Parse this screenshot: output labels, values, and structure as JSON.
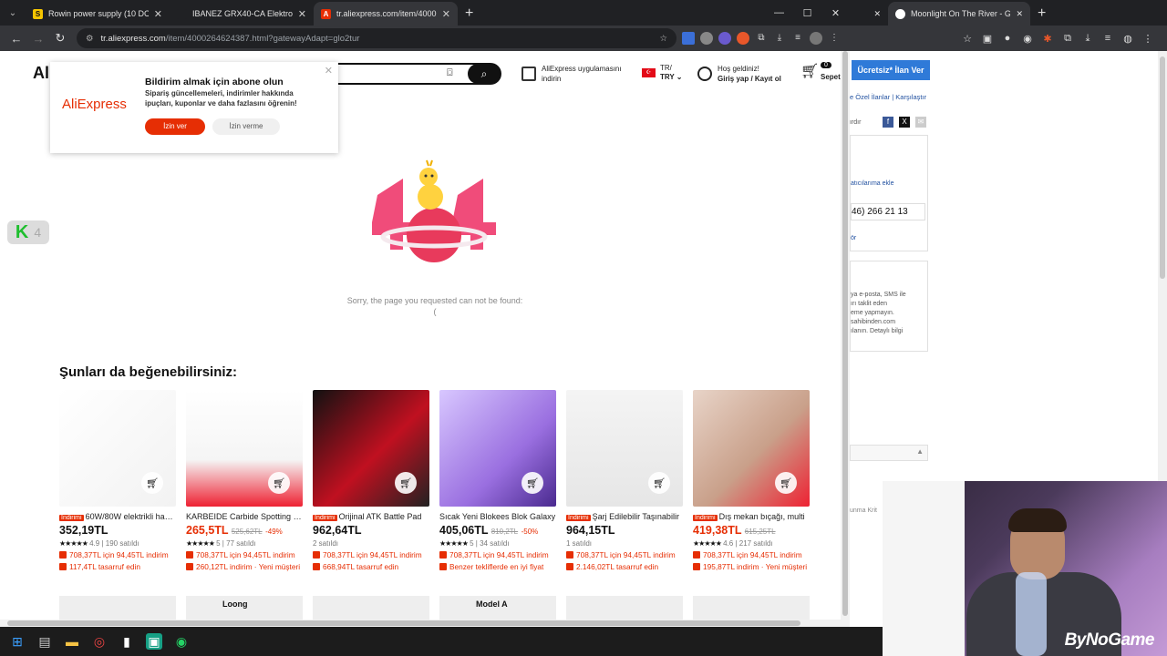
{
  "browser": {
    "tabs": [
      {
        "title": "Rowin power supply (10 DC Ou",
        "favicon": "S",
        "favicon_color": "#f7c600"
      },
      {
        "title": "IBANEZ GRX40-CA Elektro Gitar",
        "favicon": "",
        "favicon_color": "#202124"
      },
      {
        "title": "tr.aliexpress.com/item/4000264",
        "favicon": "A",
        "favicon_color": "#e62e04"
      }
    ],
    "url_host": "tr.aliexpress.com",
    "url_path": "/item/4000264624387.html?gatewayAdapt=glo2tur"
  },
  "header": {
    "logo_fragment": "Al",
    "app_line1": "AliExpress uygulamasını",
    "app_line2": "indirin",
    "lang_line1": "TR/",
    "lang_line2": "TRY",
    "user_line1": "Hoş geldiniz!",
    "user_line2": "Giriş yap / Kayıt ol",
    "cart_count": "0",
    "cart_label": "Sepet"
  },
  "popup": {
    "logo": "AliExpress",
    "title": "Bildirim almak için abone olun",
    "text": "Sipariş güncellemeleri, indirimler hakkında ipuçları, kuponlar ve daha fazlasını öğrenin!",
    "allow": "İzin ver",
    "deny": "İzin verme"
  },
  "k_badge": {
    "letter": "K",
    "count": "4"
  },
  "error": {
    "message": "Sorry, the page you requested can not be found:("
  },
  "section_title": "Şunları da beğenebilirsiniz:",
  "products": [
    {
      "tag": "İndirimi",
      "title": "60W/80W elektrikli havya",
      "price": "352,19TL",
      "price_red": false,
      "old": "",
      "disc": "",
      "stars": "★★★★★",
      "rating": "4.9",
      "sold": "190 satıldı",
      "promo1": "708,37TL için 94,45TL indirim",
      "promo2": "117,4TL tasarruf edin",
      "img": "solder"
    },
    {
      "tag": "",
      "title": "KARBEIDE Carbide Spotting Drill",
      "price": "265,5TL",
      "price_red": true,
      "old": "525,62TL",
      "disc": "-49%",
      "stars": "★★★★★",
      "rating": "5",
      "sold": "77 satıldı",
      "promo1": "708,37TL için 94,45TL indirim",
      "promo2": "260,12TL indirim · Yeni müşteri",
      "img": "drill"
    },
    {
      "tag": "İndirimi",
      "title": "Orijinal ATK Battle Pad",
      "price": "962,64TL",
      "price_red": false,
      "old": "",
      "disc": "",
      "stars": "",
      "rating": "",
      "sold": "2 satıldı",
      "promo1": "708,37TL için 94,45TL indirim",
      "promo2": "668,94TL tasarruf edin",
      "img": "pad"
    },
    {
      "tag": "",
      "title": "Sıcak Yeni Blokees Blok Galaxy",
      "price": "405,06TL",
      "price_red": false,
      "old": "810,2TL",
      "disc": "-50%",
      "stars": "★★★★★",
      "rating": "5",
      "sold": "34 satıldı",
      "promo1": "708,37TL için 94,45TL indirim",
      "promo2": "Benzer tekliflerde en iyi fiyat",
      "img": "robot"
    },
    {
      "tag": "İndirimi",
      "title": "Şarj Edilebilir Taşınabilir",
      "price": "964,15TL",
      "price_red": false,
      "old": "",
      "disc": "",
      "stars": "",
      "rating": "",
      "sold": "1 satıldı",
      "promo1": "708,37TL için 94,45TL indirim",
      "promo2": "2.146,02TL tasarruf edin",
      "img": "wireless"
    },
    {
      "tag": "İndirimi",
      "title": "Dış mekan bıçağı, multi",
      "price": "419,38TL",
      "price_red": true,
      "old": "615,25TL",
      "disc": "",
      "stars": "★★★★★",
      "rating": "4.6",
      "sold": "217 satıldı",
      "promo1": "708,37TL için 94,45TL indirim",
      "promo2": "195,87TL indirim · Yeni müşteri",
      "img": "knife"
    }
  ],
  "row2_labels": [
    "",
    "Loong",
    "",
    "Model A",
    "",
    ""
  ],
  "right_window": {
    "tab_title": "Moonlight On The River - Google",
    "blue_button": "Ücretsiz* İlan Ver",
    "links": "e Özel İlanlar  |  Karşılaştır",
    "side_text1": "ırdır",
    "fav_link": "atıcılarıma ekle",
    "phone": "46) 266 21 13",
    "small_link": "ör",
    "warn1": "ya e-posta, SMS ile",
    "warn2": "ırı taklit eden",
    "warn3": "eme yapmayın.",
    "warn4": "sahibinden.com",
    "warn5": "ılanın. Detaylı bilgi",
    "red_link": "unma Krit"
  },
  "webcam_watermark": "ByNoGame"
}
